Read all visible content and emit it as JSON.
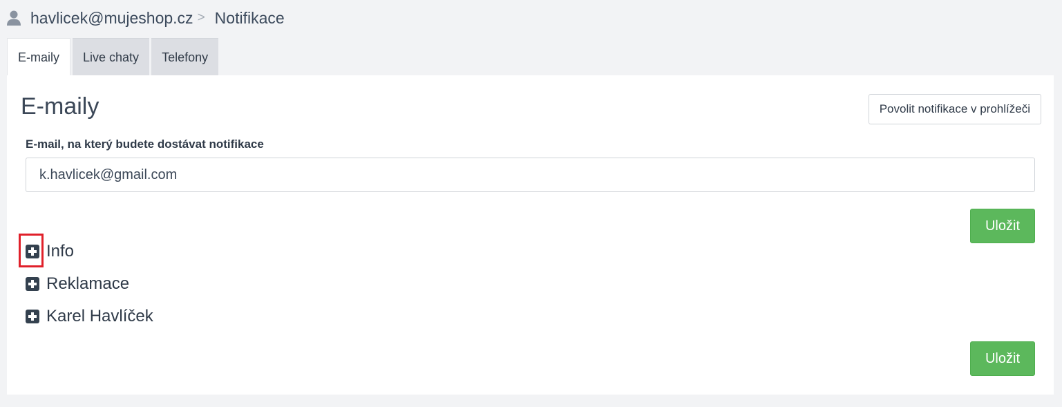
{
  "breadcrumb": {
    "account": "havlicek@mujeshop.cz",
    "separator": ">",
    "current": "Notifikace"
  },
  "tabs": [
    {
      "label": "E-maily",
      "active": true
    },
    {
      "label": "Live chaty",
      "active": false
    },
    {
      "label": "Telefony",
      "active": false
    }
  ],
  "panel": {
    "title": "E-maily",
    "browser_notify_label": "Povolit notifikace v prohlížeči",
    "email_field_label": "E-mail, na který budete dostávat notifikace",
    "email_value": "k.havlicek@gmail.com",
    "save_label": "Uložit"
  },
  "groups": [
    {
      "label": "Info",
      "icon": "plus-square-icon",
      "highlighted": true
    },
    {
      "label": "Reklamace",
      "icon": "plus-square-icon"
    },
    {
      "label": "Karel Havlíček",
      "icon": "plus-square-icon"
    }
  ],
  "colors": {
    "save_button": "#5cb85c",
    "highlight_border": "#e0202a",
    "page_background": "#f2f3f5"
  }
}
